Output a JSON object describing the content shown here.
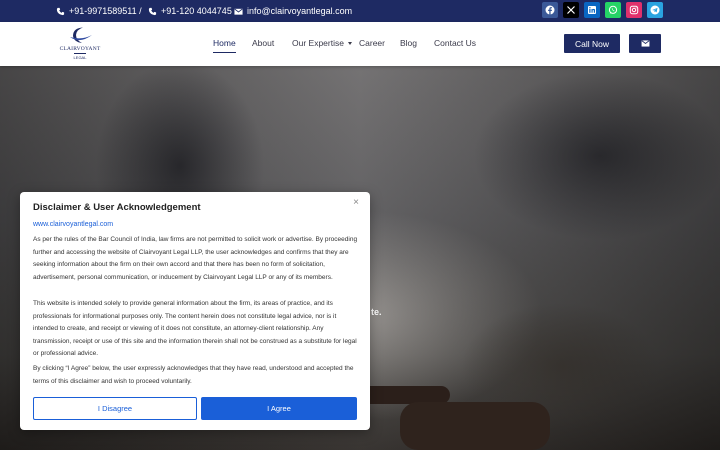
{
  "topbar": {
    "phone1": "+91-9971589511 /",
    "phone2": "+91-120 4044745",
    "email": "info@clairvoyantlegal.com",
    "socials": [
      {
        "name": "facebook",
        "color": "#3b5998"
      },
      {
        "name": "x-twitter",
        "color": "#000000"
      },
      {
        "name": "linkedin",
        "color": "#0a66c2"
      },
      {
        "name": "whatsapp",
        "color": "#25d366"
      },
      {
        "name": "instagram",
        "color": "#e1306c"
      },
      {
        "name": "telegram",
        "color": "#2aa3e0"
      }
    ]
  },
  "brand": {
    "name": "CLAIRVOYANT",
    "sub": "LEGAL"
  },
  "nav": {
    "items": [
      "Home",
      "About",
      "Our Expertise",
      "Career",
      "Blog",
      "Contact Us"
    ],
    "active": "Home",
    "call_label": "Call Now"
  },
  "hero": {
    "peek_text": "te."
  },
  "modal": {
    "title": "Disclaimer & User Acknowledgement",
    "close_glyph": "×",
    "site": "www.clairvoyantlegal.com",
    "para1": "As per the rules of the Bar Council of India, law firms are not permitted to solicit work or advertise. By proceeding further and accessing the website of Clairvoyant Legal LLP, the user acknowledges and confirms that they are seeking information about the firm on their own accord and that there has been no form of solicitation, advertisement, personal communication, or inducement by Clairvoyant Legal LLP or any of its members.",
    "para2": "This website is intended solely to provide general information about the firm, its areas of practice, and its professionals for informational purposes only. The content herein does not constitute legal advice, nor is it intended to create, and receipt or viewing of it does not constitute, an attorney-client relationship. Any transmission, receipt or use of this site and the information therein shall not be construed as a substitute for legal or professional advice.",
    "para3": "By clicking “I Agree” below, the user expressly acknowledges that they have read, understood and accepted the terms of this disclaimer and wish to proceed voluntarily.",
    "disagree_label": "I Disagree",
    "agree_label": "I Agree"
  },
  "colors": {
    "brand_navy": "#1e2a63",
    "accent_blue": "#1a5fd8"
  }
}
